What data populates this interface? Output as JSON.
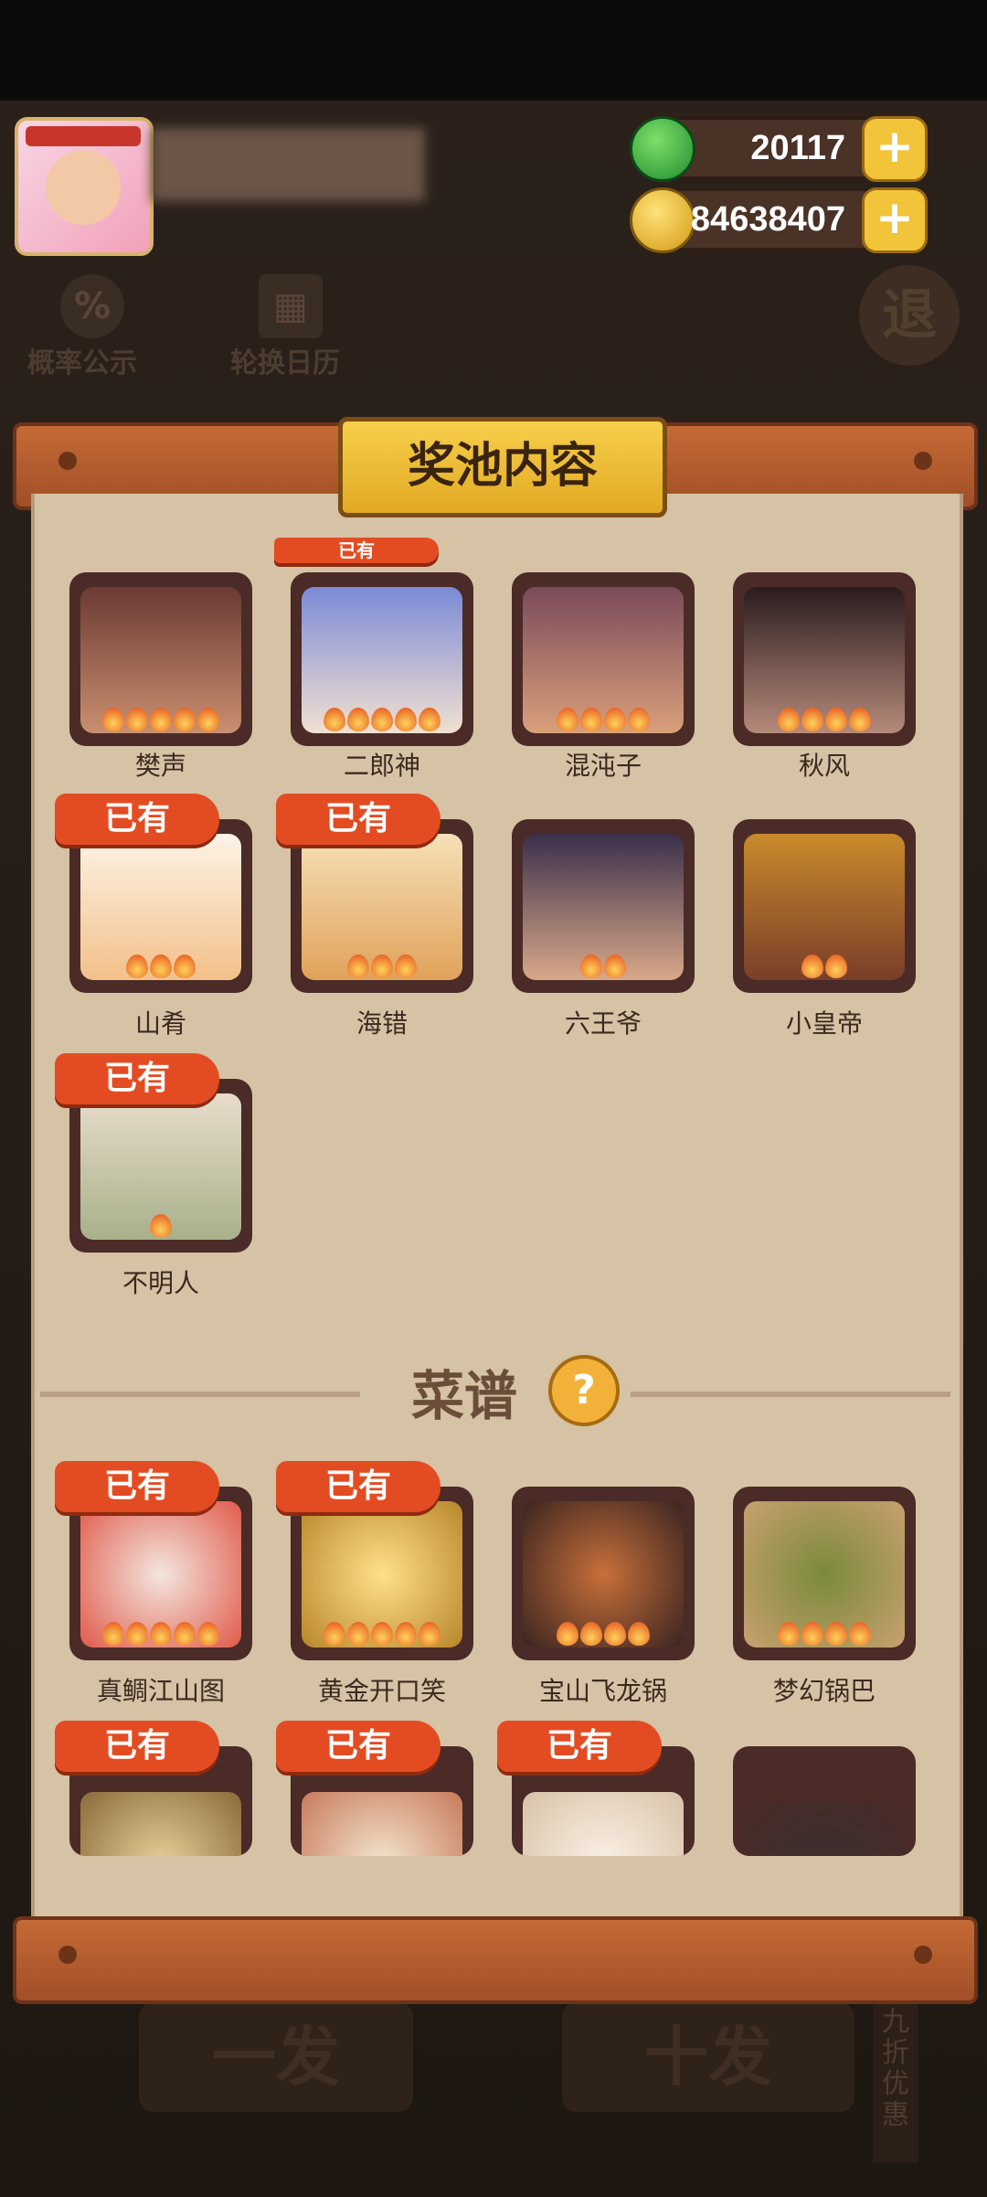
{
  "resources": {
    "jade": {
      "value": "20117",
      "icon": "jade-coin-icon"
    },
    "gold": {
      "value": "84638407",
      "icon": "gold-coin-icon"
    }
  },
  "background": {
    "probability_label": "概率公示",
    "calendar_label": "轮换日历",
    "retreat_label": "退",
    "single_draw": "一发",
    "ten_draw": "十发",
    "discount_label": "九折优惠"
  },
  "panel": {
    "title": "奖池内容",
    "owned_label": "已有",
    "characters": [
      {
        "name": "樊声",
        "flames": 5,
        "owned": false
      },
      {
        "name": "二郎神",
        "flames": 5,
        "owned": true
      },
      {
        "name": "混沌子",
        "flames": 4,
        "owned": false
      },
      {
        "name": "秋风",
        "flames": 4,
        "owned": false
      },
      {
        "name": "山肴",
        "flames": 3,
        "owned": true
      },
      {
        "name": "海错",
        "flames": 3,
        "owned": true
      },
      {
        "name": "六王爷",
        "flames": 2,
        "owned": false
      },
      {
        "name": "小皇帝",
        "flames": 2,
        "owned": false
      },
      {
        "name": "不明人",
        "flames": 1,
        "owned": true
      }
    ],
    "recipes_title": "菜谱",
    "recipes": [
      {
        "name": "真鲷江山图",
        "flames": 5,
        "owned": true
      },
      {
        "name": "黄金开口笑",
        "flames": 5,
        "owned": true
      },
      {
        "name": "宝山飞龙锅",
        "flames": 4,
        "owned": false
      },
      {
        "name": "梦幻锅巴",
        "flames": 4,
        "owned": false
      },
      {
        "name": "",
        "flames": 0,
        "owned": true
      },
      {
        "name": "",
        "flames": 0,
        "owned": true
      },
      {
        "name": "",
        "flames": 0,
        "owned": true
      },
      {
        "name": "",
        "flames": 0,
        "owned": false
      }
    ]
  }
}
